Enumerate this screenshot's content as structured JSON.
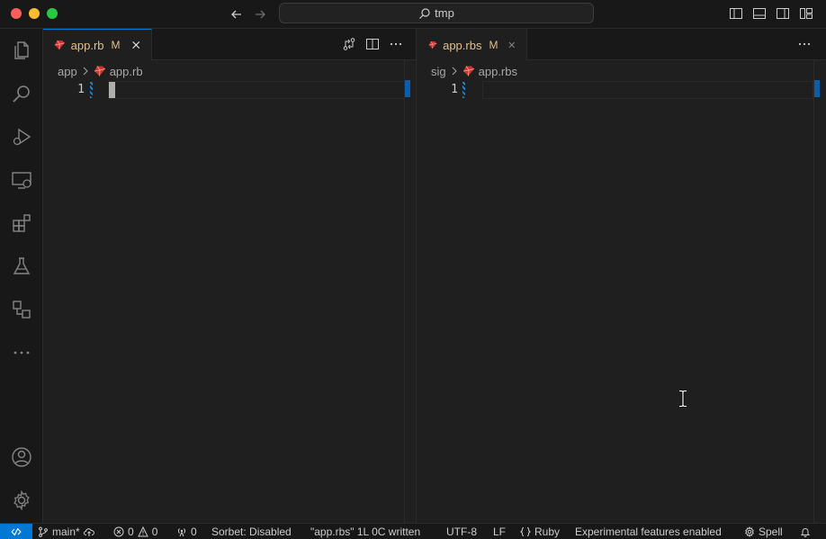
{
  "titlebar": {
    "search_text": "tmp",
    "nav_back_icon": "arrow-left-icon",
    "nav_forward_icon": "arrow-right-icon"
  },
  "activitybar": {
    "items": [
      "explorer-icon",
      "search-icon",
      "run-debug-icon",
      "remote-explorer-icon",
      "extensions-icon",
      "testing-icon",
      "source-control-graph-icon",
      "more-icon"
    ],
    "bottom": [
      "account-icon",
      "settings-gear-icon"
    ]
  },
  "editor_left": {
    "tab": {
      "name": "app.rb",
      "modified": "M"
    },
    "breadcrumb": {
      "folder": "app",
      "file": "app.rb"
    },
    "line_number": "1"
  },
  "editor_right": {
    "tab": {
      "name": "app.rbs",
      "modified": "M"
    },
    "breadcrumb": {
      "folder": "sig",
      "file": "app.rbs"
    },
    "line_number": "1"
  },
  "statusbar": {
    "branch": "main*",
    "errors": "0",
    "warnings": "0",
    "ports": "0",
    "sorbet": "Sorbet: Disabled",
    "message": "\"app.rbs\" 1L 0C written",
    "encoding": "UTF-8",
    "eol": "LF",
    "language": "Ruby",
    "experimental": "Experimental features enabled",
    "spell": "Spell"
  },
  "colors": {
    "accent": "#0078d4",
    "modified": "#e2c08d",
    "ruby": "#cc342d"
  }
}
